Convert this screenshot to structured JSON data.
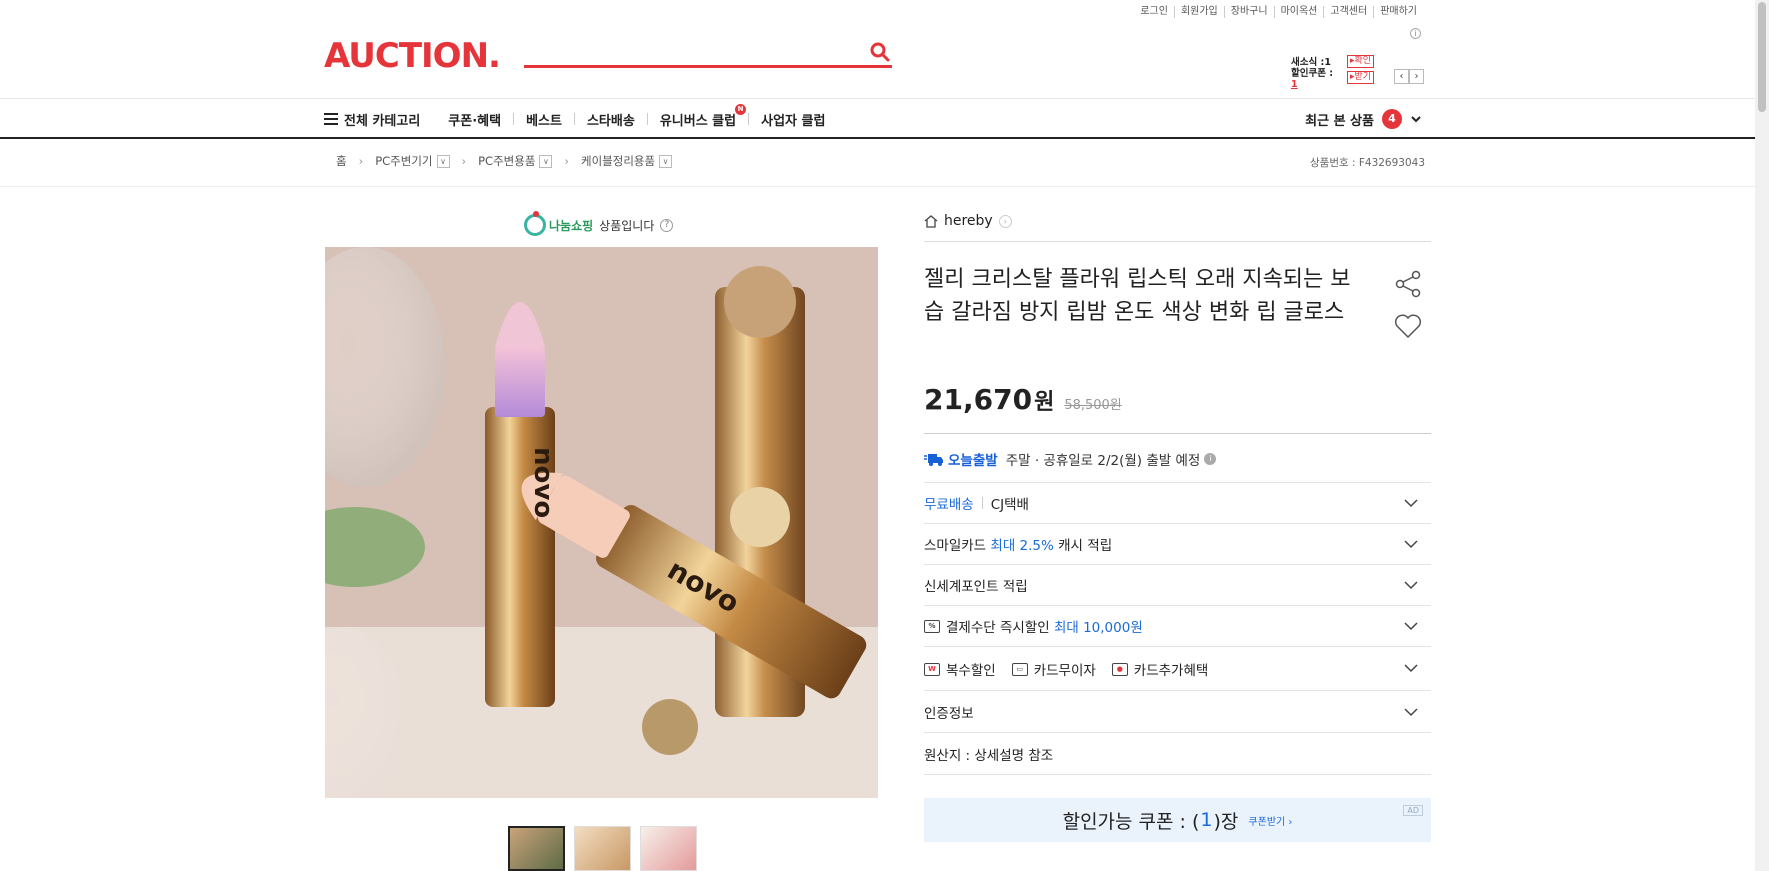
{
  "util_links": [
    "로그인",
    "회원가입",
    "장바구니",
    "마이옥션",
    "고객센터",
    "판매하기"
  ],
  "header": {
    "logo": "AUCTION.",
    "search_placeholder": "",
    "mail_label": "새소식 :",
    "mail_count": "1",
    "mail_btn": "▸확인",
    "coupon_label": "할인쿠폰 :",
    "coupon_count": "1",
    "coupon_btn": "▸받기"
  },
  "nav": {
    "all_category": "전체 카테고리",
    "items": [
      "쿠폰·혜택",
      "베스트",
      "스타배송",
      "유니버스 클럽",
      "사업자 클럽"
    ],
    "new_badge": "N",
    "recent_label": "최근 본 상품",
    "recent_count": "4"
  },
  "breadcrumb": {
    "home": "홈",
    "level1": "PC주변기기",
    "level2": "PC주변용품",
    "level3": "케이블정리용품",
    "product_no": "상품번호 : F432693043"
  },
  "share_banner": {
    "brand": "나눔쇼핑",
    "text": "상품입니다"
  },
  "product": {
    "shop_name": "hereby",
    "title": "젤리 크리스탈 플라워 립스틱 오래 지속되는 보습 갈라짐 방지 립밤 온도 색상 변화 립 글로스",
    "price": "21,670",
    "price_unit": "원",
    "original_price": "58,500원",
    "delivery_today_badge": "오늘출발",
    "delivery_today_text": "주말 · 공휴일로 2/2(월) 출발 예정",
    "shipping_free": "무료배송",
    "shipping_company": "CJ택배",
    "smilecard_prefix": "스마일카드",
    "smilecard_rate": "최대 2.5%",
    "smilecard_suffix": "캐시 적립",
    "shinsegae_point": "신세계포인트 적립",
    "payment_prefix": "결제수단 즉시할인",
    "payment_max": "최대 10,000원",
    "multi_discount": "복수할인",
    "card_installment": "카드무이자",
    "card_benefit": "카드추가혜택",
    "certification": "인증정보",
    "origin": "원산지 : 상세설명 참조",
    "coupon_bar_prefix": "할인가능 쿠폰 : (",
    "coupon_bar_count": "1",
    "coupon_bar_suffix": ")장",
    "coupon_bar_get": "쿠폰받기 ›",
    "ad_label": "AD"
  },
  "colors": {
    "brand_red": "#e5343a",
    "link_blue": "#1a6bd8",
    "coupon_bg": "#eaf2fc"
  }
}
